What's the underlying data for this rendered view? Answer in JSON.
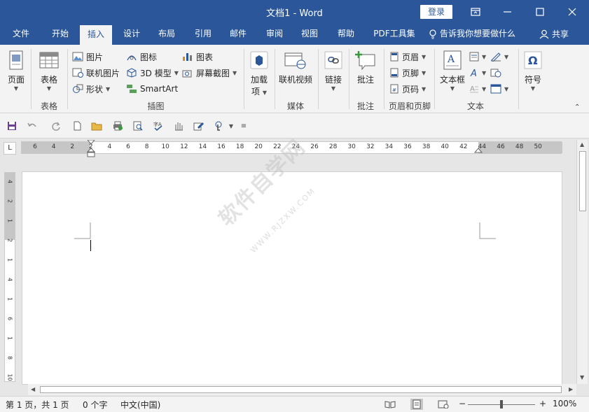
{
  "window": {
    "title": "文档1  -  Word",
    "login_label": "登录"
  },
  "tabs": [
    "文件",
    "开始",
    "插入",
    "设计",
    "布局",
    "引用",
    "邮件",
    "审阅",
    "视图",
    "帮助",
    "PDF工具集"
  ],
  "active_tab": "插入",
  "tell_me": "告诉我你想要做什么",
  "share": "共享",
  "ribbon": {
    "pages": {
      "label": "页面",
      "group": ""
    },
    "tables": {
      "label": "表格",
      "group": "表格"
    },
    "illustrations": {
      "picture": "图片",
      "online_picture": "联机图片",
      "shapes": "形状",
      "icons": "图标",
      "model3d": "3D 模型",
      "smartart": "SmartArt",
      "chart": "图表",
      "screenshot": "屏幕截图",
      "group": "插图"
    },
    "addins": {
      "label1": "加载",
      "label2": "项"
    },
    "media": {
      "online_video": "联机视频",
      "group": "媒体"
    },
    "links": {
      "label": "链接"
    },
    "comments": {
      "label": "批注",
      "group": "批注"
    },
    "header_footer": {
      "header": "页眉",
      "footer": "页脚",
      "page_number": "页码",
      "group": "页眉和页脚"
    },
    "text": {
      "textbox": "文本框",
      "group": "文本"
    },
    "symbols": {
      "label": "符号"
    }
  },
  "ruler": {
    "h_ticks": [
      "6",
      "4",
      "2",
      "2",
      "4",
      "6",
      "8",
      "10",
      "12",
      "14",
      "16",
      "18",
      "20",
      "22",
      "24",
      "26",
      "28",
      "30",
      "32",
      "34",
      "36",
      "38",
      "40",
      "42",
      "44",
      "46",
      "48",
      "50"
    ],
    "v_ticks": [
      "4",
      "2",
      "1",
      "2",
      "1",
      "4",
      "1",
      "6",
      "1",
      "8",
      "10"
    ]
  },
  "watermark": {
    "main": "软件自学网",
    "sub": "WWW.RJZXW.COM"
  },
  "status": {
    "page": "第 1 页，共 1 页",
    "words": "0 个字",
    "language": "中文(中国)",
    "zoom_minus": "−",
    "zoom_plus": "+",
    "zoom": "100%",
    "zoom_level": 1.0
  },
  "colors": {
    "accent": "#2b579a",
    "ribbon_bg": "#f3f3f3"
  }
}
